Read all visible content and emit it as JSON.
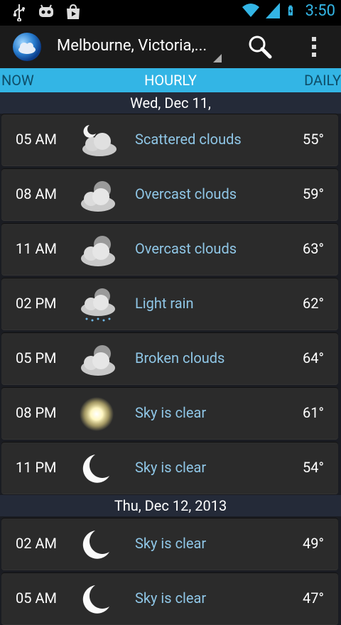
{
  "status_bar": {
    "time": "3:50",
    "left_icons": [
      "usb-icon",
      "android-debug-icon",
      "play-store-icon"
    ],
    "right_icons": [
      "wifi-icon",
      "signal-icon",
      "battery-icon"
    ]
  },
  "action_bar": {
    "location": "Melbourne, Victoria,...",
    "icons": [
      "app-globe-icon",
      "search-icon",
      "overflow-menu-icon"
    ]
  },
  "tabs": [
    {
      "label": "NOW"
    },
    {
      "label": "HOURLY"
    },
    {
      "label": "DAILY"
    }
  ],
  "selected_tab": "HOURLY",
  "date_headers": [
    "Wed, Dec 11,",
    "Thu, Dec 12, 2013"
  ],
  "rows": [
    {
      "time": "05 AM",
      "condition": "Scattered clouds",
      "temp": "55°",
      "icon": "night-cloud-icon"
    },
    {
      "time": "08 AM",
      "condition": "Overcast clouds",
      "temp": "59°",
      "icon": "overcast-icon"
    },
    {
      "time": "11 AM",
      "condition": "Overcast clouds",
      "temp": "63°",
      "icon": "overcast-icon"
    },
    {
      "time": "02 PM",
      "condition": "Light rain",
      "temp": "62°",
      "icon": "rain-icon"
    },
    {
      "time": "05 PM",
      "condition": "Broken clouds",
      "temp": "64°",
      "icon": "overcast-icon"
    },
    {
      "time": "08 PM",
      "condition": "Sky is clear",
      "temp": "61°",
      "icon": "sun-icon"
    },
    {
      "time": "11 PM",
      "condition": "Sky is clear",
      "temp": "54°",
      "icon": "moon-icon"
    },
    {
      "time": "02 AM",
      "condition": "Sky is clear",
      "temp": "49°",
      "icon": "moon-icon"
    },
    {
      "time": "05 AM",
      "condition": "Sky is clear",
      "temp": "47°",
      "icon": "moon-icon"
    }
  ],
  "colors": {
    "accent": "#33b5e5",
    "condition_text": "#8fc6e6",
    "row_bg": "#2b2b2b",
    "header_bg": "#242a38"
  }
}
